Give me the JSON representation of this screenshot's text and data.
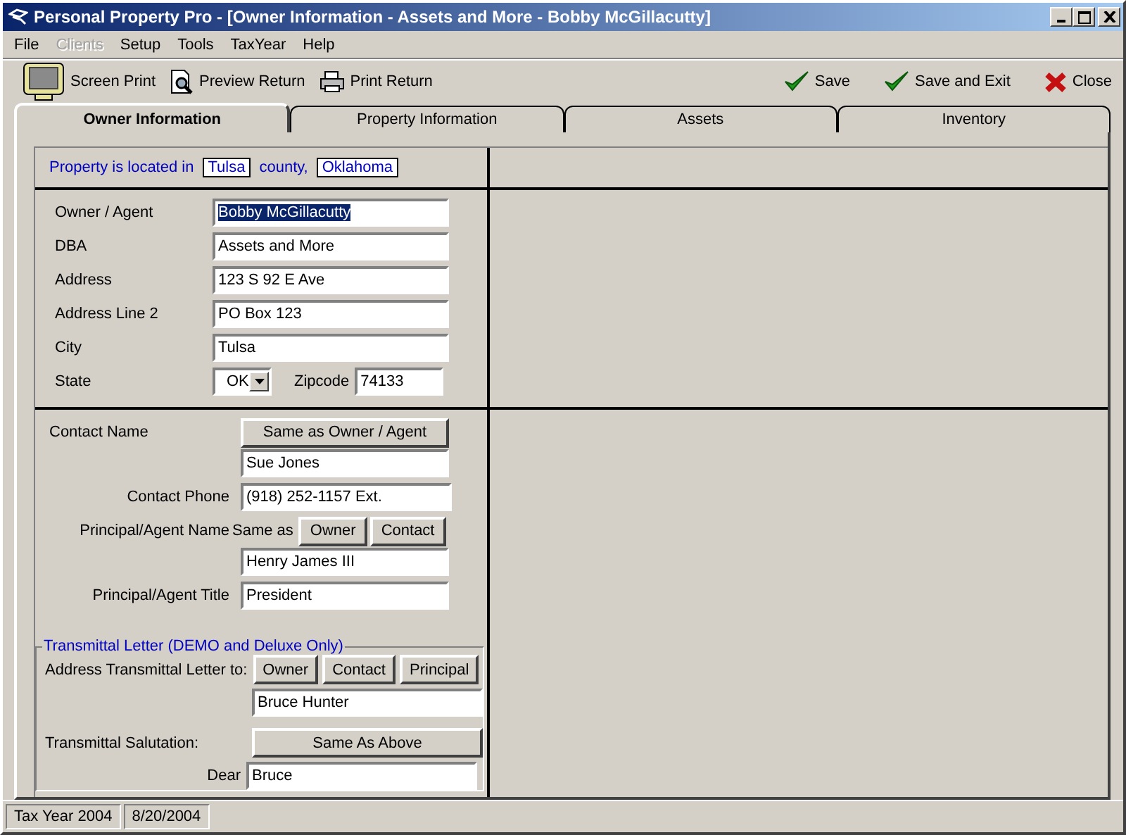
{
  "window": {
    "title": "Personal Property Pro - [Owner Information - Assets and More - Bobby McGillacutty]"
  },
  "menu": [
    {
      "label": "File",
      "disabled": false
    },
    {
      "label": "Clients",
      "disabled": true
    },
    {
      "label": "Setup",
      "disabled": false
    },
    {
      "label": "Tools",
      "disabled": false
    },
    {
      "label": "TaxYear",
      "disabled": false
    },
    {
      "label": "Help",
      "disabled": false
    }
  ],
  "toolbar_left": [
    {
      "label": "Screen Print",
      "kind": "monitor"
    },
    {
      "label": "Preview Return",
      "kind": "preview"
    },
    {
      "label": "Print Return",
      "kind": "printer"
    }
  ],
  "toolbar_right": [
    {
      "label": "Save",
      "kind": "check"
    },
    {
      "label": "Save and Exit",
      "kind": "check"
    },
    {
      "label": "Close",
      "kind": "cross"
    }
  ],
  "tabs": [
    {
      "label": "Owner Information",
      "selected": true
    },
    {
      "label": "Property Information",
      "selected": false
    },
    {
      "label": "Assets",
      "selected": false
    },
    {
      "label": "Inventory",
      "selected": false
    }
  ],
  "location": {
    "prefix": "Property is located in",
    "county": "Tulsa",
    "middle": "county,",
    "state": "Oklahoma"
  },
  "owner_fields": [
    {
      "label": "Owner / Agent",
      "value": "Bobby McGillacutty",
      "highlighted": true
    },
    {
      "label": "DBA",
      "value": "Assets and More",
      "highlighted": false
    },
    {
      "label": "Address",
      "value": "123 S 92 E Ave",
      "highlighted": false
    },
    {
      "label": "Address Line 2",
      "value": "PO Box 123",
      "highlighted": false
    },
    {
      "label": "City",
      "value": "Tulsa",
      "highlighted": false
    }
  ],
  "state": {
    "label": "State",
    "value": "OK"
  },
  "zipcode": {
    "label": "Zipcode",
    "value": "74133"
  },
  "contact": {
    "name_label": "Contact Name",
    "same_button": "Same as Owner / Agent",
    "name_value": "Sue Jones",
    "phone_label": "Contact Phone",
    "phone_value": "(918) 252-1157  Ext.",
    "principal_label": "Principal/Agent Name",
    "same_as": "Same as",
    "principal_buttons": [
      "Owner",
      "Contact"
    ],
    "principal_value": "Henry James III",
    "title_label": "Principal/Agent Title",
    "title_value": "President"
  },
  "transmittal": {
    "legend": "Transmittal Letter (DEMO and Deluxe Only)",
    "address_label": "Address Transmittal Letter to:",
    "buttons": [
      "Owner",
      "Contact",
      "Principal"
    ],
    "address_value": "Bruce Hunter",
    "salutation_label": "Transmittal Salutation:",
    "same_button": "Same As Above",
    "dear_label": "Dear",
    "dear_value": "Bruce"
  },
  "status_bar": [
    "Tax Year 2004",
    "8/20/2004"
  ]
}
